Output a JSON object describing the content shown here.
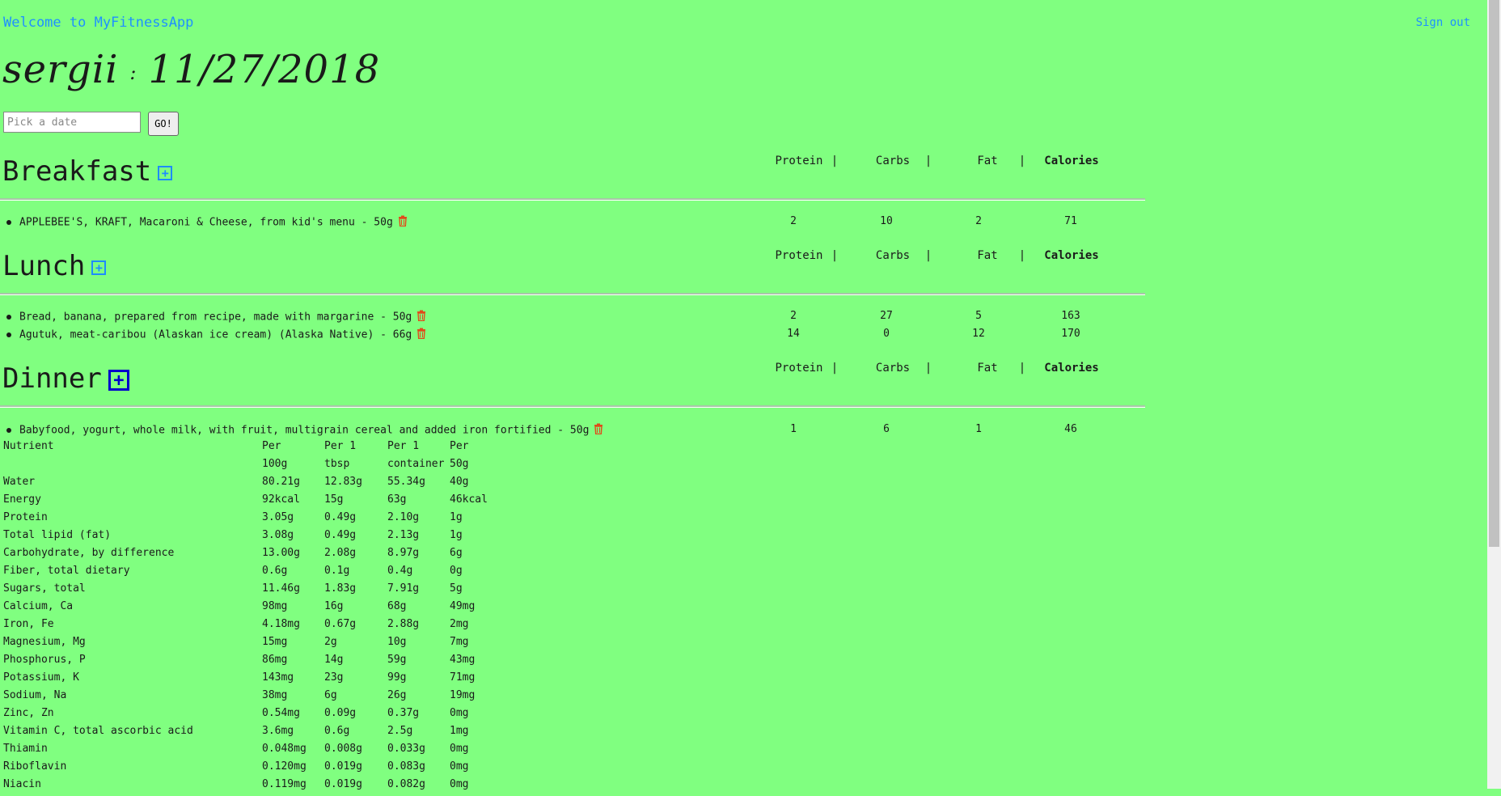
{
  "header": {
    "welcome": "Welcome to MyFitnessApp",
    "signout": "Sign out"
  },
  "title": {
    "user": "sergii",
    "sep": ":",
    "date": "11/27/2018"
  },
  "date_picker": {
    "placeholder": "Pick a date",
    "go_label": "GO!"
  },
  "columns": {
    "protein": "Protein",
    "carbs": "Carbs",
    "fat": "Fat",
    "calories": "Calories",
    "sep": "|"
  },
  "meals": {
    "breakfast": {
      "title": "Breakfast",
      "items": [
        {
          "name": "APPLEBEE'S, KRAFT, Macaroni & Cheese, from kid's menu - 50g",
          "protein": "2",
          "carbs": "10",
          "fat": "2",
          "calories": "71"
        }
      ]
    },
    "lunch": {
      "title": "Lunch",
      "items": [
        {
          "name": "Bread, banana, prepared from recipe, made with margarine - 50g",
          "protein": "2",
          "carbs": "27",
          "fat": "5",
          "calories": "163"
        },
        {
          "name": "Agutuk, meat-caribou (Alaskan ice cream) (Alaska Native) - 66g",
          "protein": "14",
          "carbs": "0",
          "fat": "12",
          "calories": "170"
        }
      ]
    },
    "dinner": {
      "title": "Dinner",
      "items": [
        {
          "name": "Babyfood, yogurt, whole milk, with fruit, multigrain cereal and added iron fortified - 50g",
          "protein": "1",
          "carbs": "6",
          "fat": "1",
          "calories": "46"
        }
      ]
    }
  },
  "nutrients": {
    "header": [
      "Nutrient",
      "Per",
      "Per 1",
      "Per 1",
      "Per"
    ],
    "header2": [
      "",
      "100g",
      "tbsp",
      "container",
      "50g"
    ],
    "rows": [
      [
        "Water",
        "80.21g",
        "12.83g",
        "55.34g",
        "40g"
      ],
      [
        "Energy",
        "92kcal",
        "15g",
        "63g",
        "46kcal"
      ],
      [
        "Protein",
        "3.05g",
        "0.49g",
        "2.10g",
        "1g"
      ],
      [
        "Total lipid (fat)",
        "3.08g",
        "0.49g",
        "2.13g",
        "1g"
      ],
      [
        "Carbohydrate, by difference",
        "13.00g",
        "2.08g",
        "8.97g",
        "6g"
      ],
      [
        "Fiber, total dietary",
        "0.6g",
        "0.1g",
        "0.4g",
        "0g"
      ],
      [
        "Sugars, total",
        "11.46g",
        "1.83g",
        "7.91g",
        "5g"
      ],
      [
        "Calcium, Ca",
        "98mg",
        "16g",
        "68g",
        "49mg"
      ],
      [
        "Iron, Fe",
        "4.18mg",
        "0.67g",
        "2.88g",
        "2mg"
      ],
      [
        "Magnesium, Mg",
        "15mg",
        "2g",
        "10g",
        "7mg"
      ],
      [
        "Phosphorus, P",
        "86mg",
        "14g",
        "59g",
        "43mg"
      ],
      [
        "Potassium, K",
        "143mg",
        "23g",
        "99g",
        "71mg"
      ],
      [
        "Sodium, Na",
        "38mg",
        "6g",
        "26g",
        "19mg"
      ],
      [
        "Zinc, Zn",
        "0.54mg",
        "0.09g",
        "0.37g",
        "0mg"
      ],
      [
        "Vitamin C, total ascorbic acid",
        "3.6mg",
        "0.6g",
        "2.5g",
        "1mg"
      ],
      [
        "Thiamin",
        "0.048mg",
        "0.008g",
        "0.033g",
        "0mg"
      ],
      [
        "Riboflavin",
        "0.120mg",
        "0.019g",
        "0.083g",
        "0mg"
      ],
      [
        "Niacin",
        "0.119mg",
        "0.019g",
        "0.082g",
        "0mg"
      ]
    ]
  },
  "colors": {
    "background": "#80ff80",
    "link": "#1e90ff",
    "trash": "#e04b1a",
    "add_icon": "#1e8cff"
  }
}
